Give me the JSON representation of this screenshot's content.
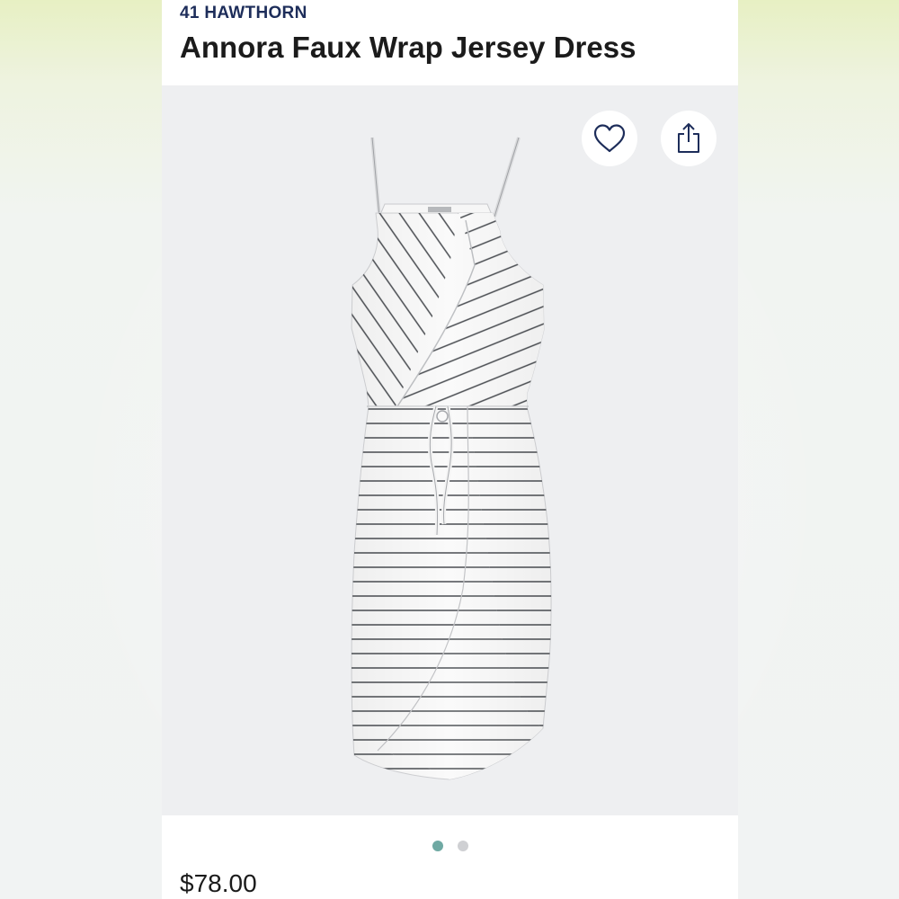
{
  "product": {
    "brand": "41 HAWTHORN",
    "title": "Annora Faux Wrap Jersey Dress",
    "price": "$78.00"
  },
  "actions": {
    "favorite_icon": "heart-icon",
    "share_icon": "share-icon"
  },
  "carousel": {
    "total_images": 2,
    "active_index": 0
  },
  "colors": {
    "brand": "#1d2d5a",
    "active_dot": "#6fa9a3",
    "inactive_dot": "#cfd0d3",
    "image_bg": "#eeeff1"
  }
}
